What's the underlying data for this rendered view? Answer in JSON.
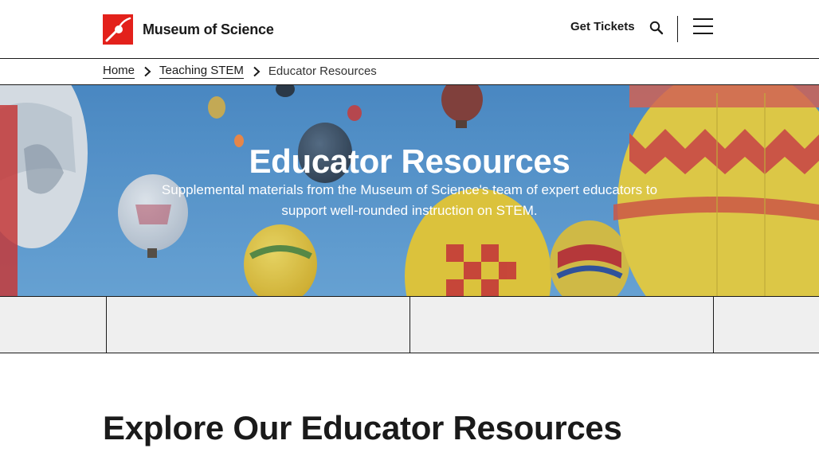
{
  "header": {
    "logo_text": "Museum of Science",
    "get_tickets_label": "Get Tickets",
    "search_icon": "search-icon",
    "menu_icon": "hamburger-menu-icon"
  },
  "breadcrumb": {
    "items": [
      {
        "label": "Home"
      },
      {
        "label": "Teaching STEM"
      }
    ],
    "current": "Educator Resources",
    "separator_icon": "chevron-right-icon"
  },
  "hero": {
    "title": "Educator Resources",
    "subtitle": "Supplemental materials from the Museum of Science's team of expert educators to support well-rounded instruction on STEM."
  },
  "main": {
    "section_title": "Explore Our Educator Resources"
  },
  "colors": {
    "brand_red": "#e3211b",
    "text": "#1a1a1a",
    "strip_bg": "#efefef",
    "sky": "#5a9cd3"
  }
}
